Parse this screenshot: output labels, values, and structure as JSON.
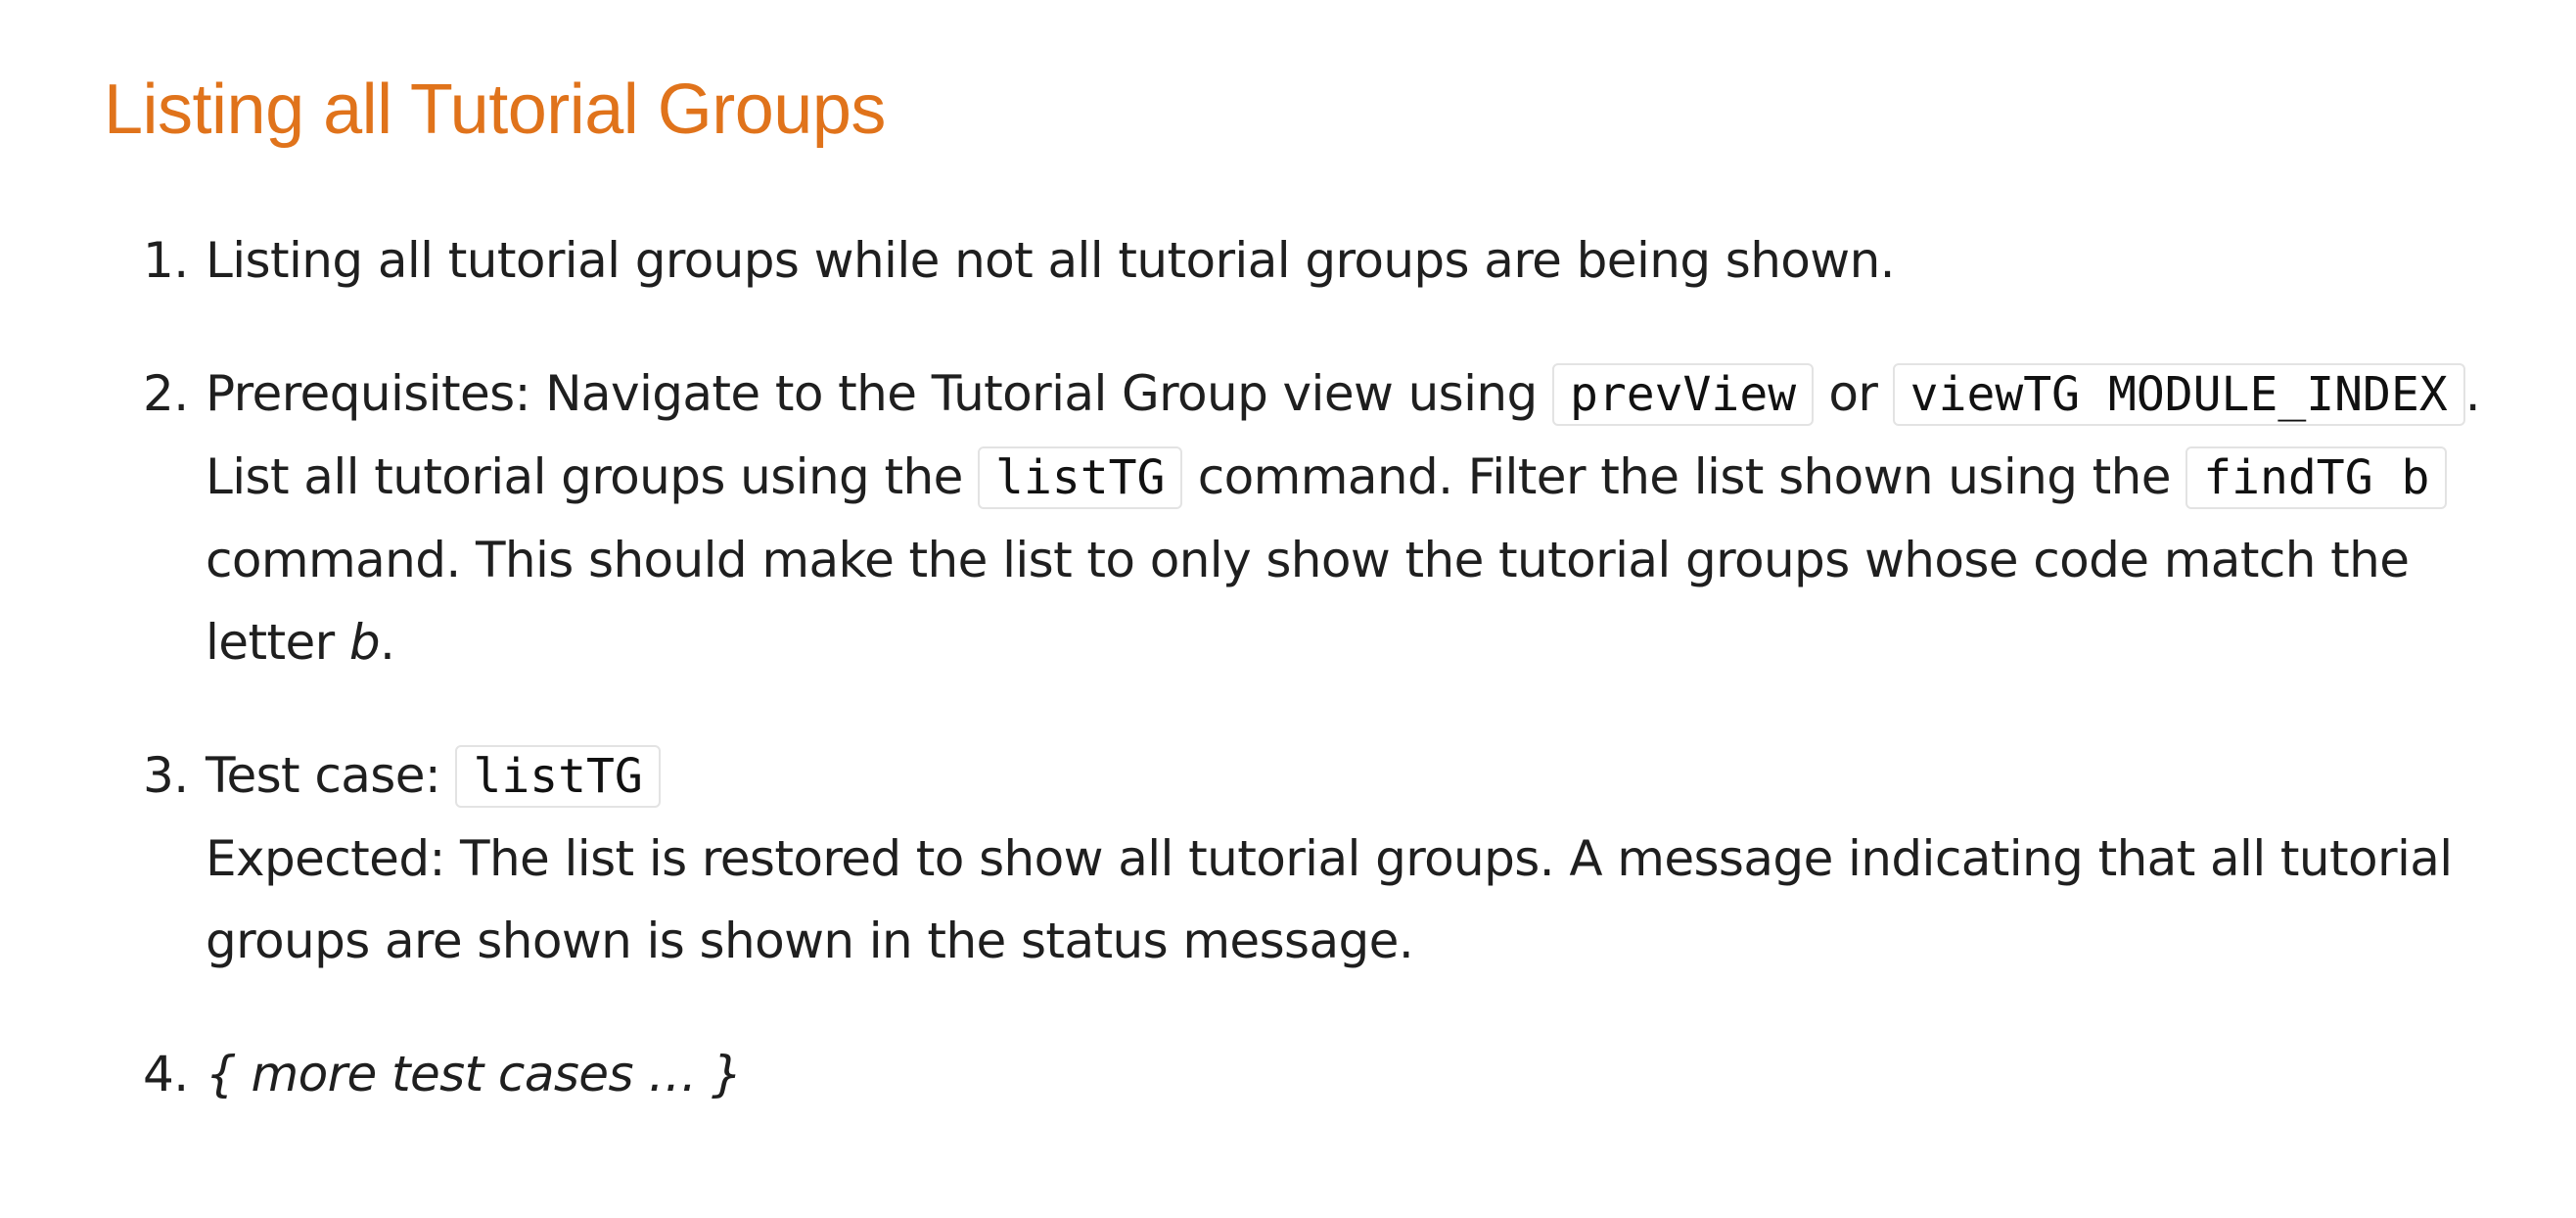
{
  "heading": "Listing all Tutorial Groups",
  "steps": [
    {
      "number": "1.",
      "text": "Listing all tutorial groups while not all tutorial groups are being shown."
    },
    {
      "number": "2.",
      "t1": "Prerequisites: Navigate to the Tutorial Group view using ",
      "c1": "prevView",
      "t2": " or ",
      "c2": "viewTG MODULE_INDEX",
      "t3": ". List all tutorial groups using the ",
      "c3": "listTG",
      "t4": " command. Filter the list shown using the ",
      "c4": "findTG b",
      "t5": " command. This should make the list to only show the tutorial groups whose code match the letter ",
      "em": "b",
      "t6": "."
    },
    {
      "number": "3.",
      "label": "Test case: ",
      "code": "listTG",
      "expected": "Expected: The list is restored to show all tutorial groups. A message indicating that all tutorial groups are shown is shown in the status message."
    },
    {
      "number": "4.",
      "text": "{ more test cases … }"
    }
  ],
  "colors": {
    "heading": "#e0731b",
    "text": "#1f1f1f",
    "code_border": "#e3e3e3"
  }
}
